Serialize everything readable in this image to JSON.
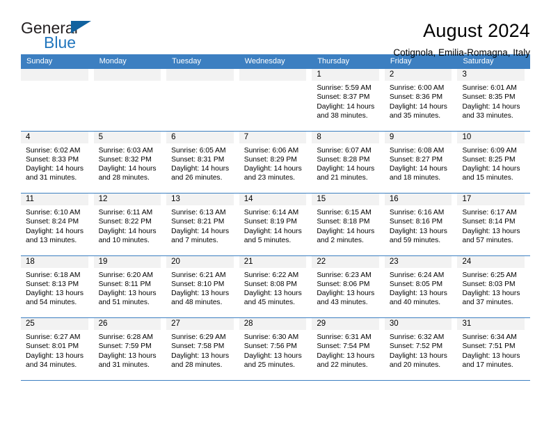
{
  "logo": {
    "text_top": "General",
    "text_bottom": "Blue",
    "triangle_color": "#11629f",
    "blue_color": "#2176bd"
  },
  "header": {
    "title": "August 2024",
    "subtitle": "Cotignola, Emilia-Romagna, Italy"
  },
  "theme": {
    "header_blue": "#3c7fc1",
    "daynum_band": "#f2f2f2",
    "text": "#000000"
  },
  "calendar": {
    "weekday_headers": [
      "Sunday",
      "Monday",
      "Tuesday",
      "Wednesday",
      "Thursday",
      "Friday",
      "Saturday"
    ],
    "weeks": [
      [
        {
          "day": "",
          "sunrise": "",
          "sunset": "",
          "daylight1": "",
          "daylight2": "",
          "empty": true
        },
        {
          "day": "",
          "sunrise": "",
          "sunset": "",
          "daylight1": "",
          "daylight2": "",
          "empty": true
        },
        {
          "day": "",
          "sunrise": "",
          "sunset": "",
          "daylight1": "",
          "daylight2": "",
          "empty": true
        },
        {
          "day": "",
          "sunrise": "",
          "sunset": "",
          "daylight1": "",
          "daylight2": "",
          "empty": true
        },
        {
          "day": "1",
          "sunrise": "Sunrise: 5:59 AM",
          "sunset": "Sunset: 8:37 PM",
          "daylight1": "Daylight: 14 hours",
          "daylight2": "and 38 minutes."
        },
        {
          "day": "2",
          "sunrise": "Sunrise: 6:00 AM",
          "sunset": "Sunset: 8:36 PM",
          "daylight1": "Daylight: 14 hours",
          "daylight2": "and 35 minutes."
        },
        {
          "day": "3",
          "sunrise": "Sunrise: 6:01 AM",
          "sunset": "Sunset: 8:35 PM",
          "daylight1": "Daylight: 14 hours",
          "daylight2": "and 33 minutes."
        }
      ],
      [
        {
          "day": "4",
          "sunrise": "Sunrise: 6:02 AM",
          "sunset": "Sunset: 8:33 PM",
          "daylight1": "Daylight: 14 hours",
          "daylight2": "and 31 minutes."
        },
        {
          "day": "5",
          "sunrise": "Sunrise: 6:03 AM",
          "sunset": "Sunset: 8:32 PM",
          "daylight1": "Daylight: 14 hours",
          "daylight2": "and 28 minutes."
        },
        {
          "day": "6",
          "sunrise": "Sunrise: 6:05 AM",
          "sunset": "Sunset: 8:31 PM",
          "daylight1": "Daylight: 14 hours",
          "daylight2": "and 26 minutes."
        },
        {
          "day": "7",
          "sunrise": "Sunrise: 6:06 AM",
          "sunset": "Sunset: 8:29 PM",
          "daylight1": "Daylight: 14 hours",
          "daylight2": "and 23 minutes."
        },
        {
          "day": "8",
          "sunrise": "Sunrise: 6:07 AM",
          "sunset": "Sunset: 8:28 PM",
          "daylight1": "Daylight: 14 hours",
          "daylight2": "and 21 minutes."
        },
        {
          "day": "9",
          "sunrise": "Sunrise: 6:08 AM",
          "sunset": "Sunset: 8:27 PM",
          "daylight1": "Daylight: 14 hours",
          "daylight2": "and 18 minutes."
        },
        {
          "day": "10",
          "sunrise": "Sunrise: 6:09 AM",
          "sunset": "Sunset: 8:25 PM",
          "daylight1": "Daylight: 14 hours",
          "daylight2": "and 15 minutes."
        }
      ],
      [
        {
          "day": "11",
          "sunrise": "Sunrise: 6:10 AM",
          "sunset": "Sunset: 8:24 PM",
          "daylight1": "Daylight: 14 hours",
          "daylight2": "and 13 minutes."
        },
        {
          "day": "12",
          "sunrise": "Sunrise: 6:11 AM",
          "sunset": "Sunset: 8:22 PM",
          "daylight1": "Daylight: 14 hours",
          "daylight2": "and 10 minutes."
        },
        {
          "day": "13",
          "sunrise": "Sunrise: 6:13 AM",
          "sunset": "Sunset: 8:21 PM",
          "daylight1": "Daylight: 14 hours",
          "daylight2": "and 7 minutes."
        },
        {
          "day": "14",
          "sunrise": "Sunrise: 6:14 AM",
          "sunset": "Sunset: 8:19 PM",
          "daylight1": "Daylight: 14 hours",
          "daylight2": "and 5 minutes."
        },
        {
          "day": "15",
          "sunrise": "Sunrise: 6:15 AM",
          "sunset": "Sunset: 8:18 PM",
          "daylight1": "Daylight: 14 hours",
          "daylight2": "and 2 minutes."
        },
        {
          "day": "16",
          "sunrise": "Sunrise: 6:16 AM",
          "sunset": "Sunset: 8:16 PM",
          "daylight1": "Daylight: 13 hours",
          "daylight2": "and 59 minutes."
        },
        {
          "day": "17",
          "sunrise": "Sunrise: 6:17 AM",
          "sunset": "Sunset: 8:14 PM",
          "daylight1": "Daylight: 13 hours",
          "daylight2": "and 57 minutes."
        }
      ],
      [
        {
          "day": "18",
          "sunrise": "Sunrise: 6:18 AM",
          "sunset": "Sunset: 8:13 PM",
          "daylight1": "Daylight: 13 hours",
          "daylight2": "and 54 minutes."
        },
        {
          "day": "19",
          "sunrise": "Sunrise: 6:20 AM",
          "sunset": "Sunset: 8:11 PM",
          "daylight1": "Daylight: 13 hours",
          "daylight2": "and 51 minutes."
        },
        {
          "day": "20",
          "sunrise": "Sunrise: 6:21 AM",
          "sunset": "Sunset: 8:10 PM",
          "daylight1": "Daylight: 13 hours",
          "daylight2": "and 48 minutes."
        },
        {
          "day": "21",
          "sunrise": "Sunrise: 6:22 AM",
          "sunset": "Sunset: 8:08 PM",
          "daylight1": "Daylight: 13 hours",
          "daylight2": "and 45 minutes."
        },
        {
          "day": "22",
          "sunrise": "Sunrise: 6:23 AM",
          "sunset": "Sunset: 8:06 PM",
          "daylight1": "Daylight: 13 hours",
          "daylight2": "and 43 minutes."
        },
        {
          "day": "23",
          "sunrise": "Sunrise: 6:24 AM",
          "sunset": "Sunset: 8:05 PM",
          "daylight1": "Daylight: 13 hours",
          "daylight2": "and 40 minutes."
        },
        {
          "day": "24",
          "sunrise": "Sunrise: 6:25 AM",
          "sunset": "Sunset: 8:03 PM",
          "daylight1": "Daylight: 13 hours",
          "daylight2": "and 37 minutes."
        }
      ],
      [
        {
          "day": "25",
          "sunrise": "Sunrise: 6:27 AM",
          "sunset": "Sunset: 8:01 PM",
          "daylight1": "Daylight: 13 hours",
          "daylight2": "and 34 minutes."
        },
        {
          "day": "26",
          "sunrise": "Sunrise: 6:28 AM",
          "sunset": "Sunset: 7:59 PM",
          "daylight1": "Daylight: 13 hours",
          "daylight2": "and 31 minutes."
        },
        {
          "day": "27",
          "sunrise": "Sunrise: 6:29 AM",
          "sunset": "Sunset: 7:58 PM",
          "daylight1": "Daylight: 13 hours",
          "daylight2": "and 28 minutes."
        },
        {
          "day": "28",
          "sunrise": "Sunrise: 6:30 AM",
          "sunset": "Sunset: 7:56 PM",
          "daylight1": "Daylight: 13 hours",
          "daylight2": "and 25 minutes."
        },
        {
          "day": "29",
          "sunrise": "Sunrise: 6:31 AM",
          "sunset": "Sunset: 7:54 PM",
          "daylight1": "Daylight: 13 hours",
          "daylight2": "and 22 minutes."
        },
        {
          "day": "30",
          "sunrise": "Sunrise: 6:32 AM",
          "sunset": "Sunset: 7:52 PM",
          "daylight1": "Daylight: 13 hours",
          "daylight2": "and 20 minutes."
        },
        {
          "day": "31",
          "sunrise": "Sunrise: 6:34 AM",
          "sunset": "Sunset: 7:51 PM",
          "daylight1": "Daylight: 13 hours",
          "daylight2": "and 17 minutes."
        }
      ]
    ]
  }
}
